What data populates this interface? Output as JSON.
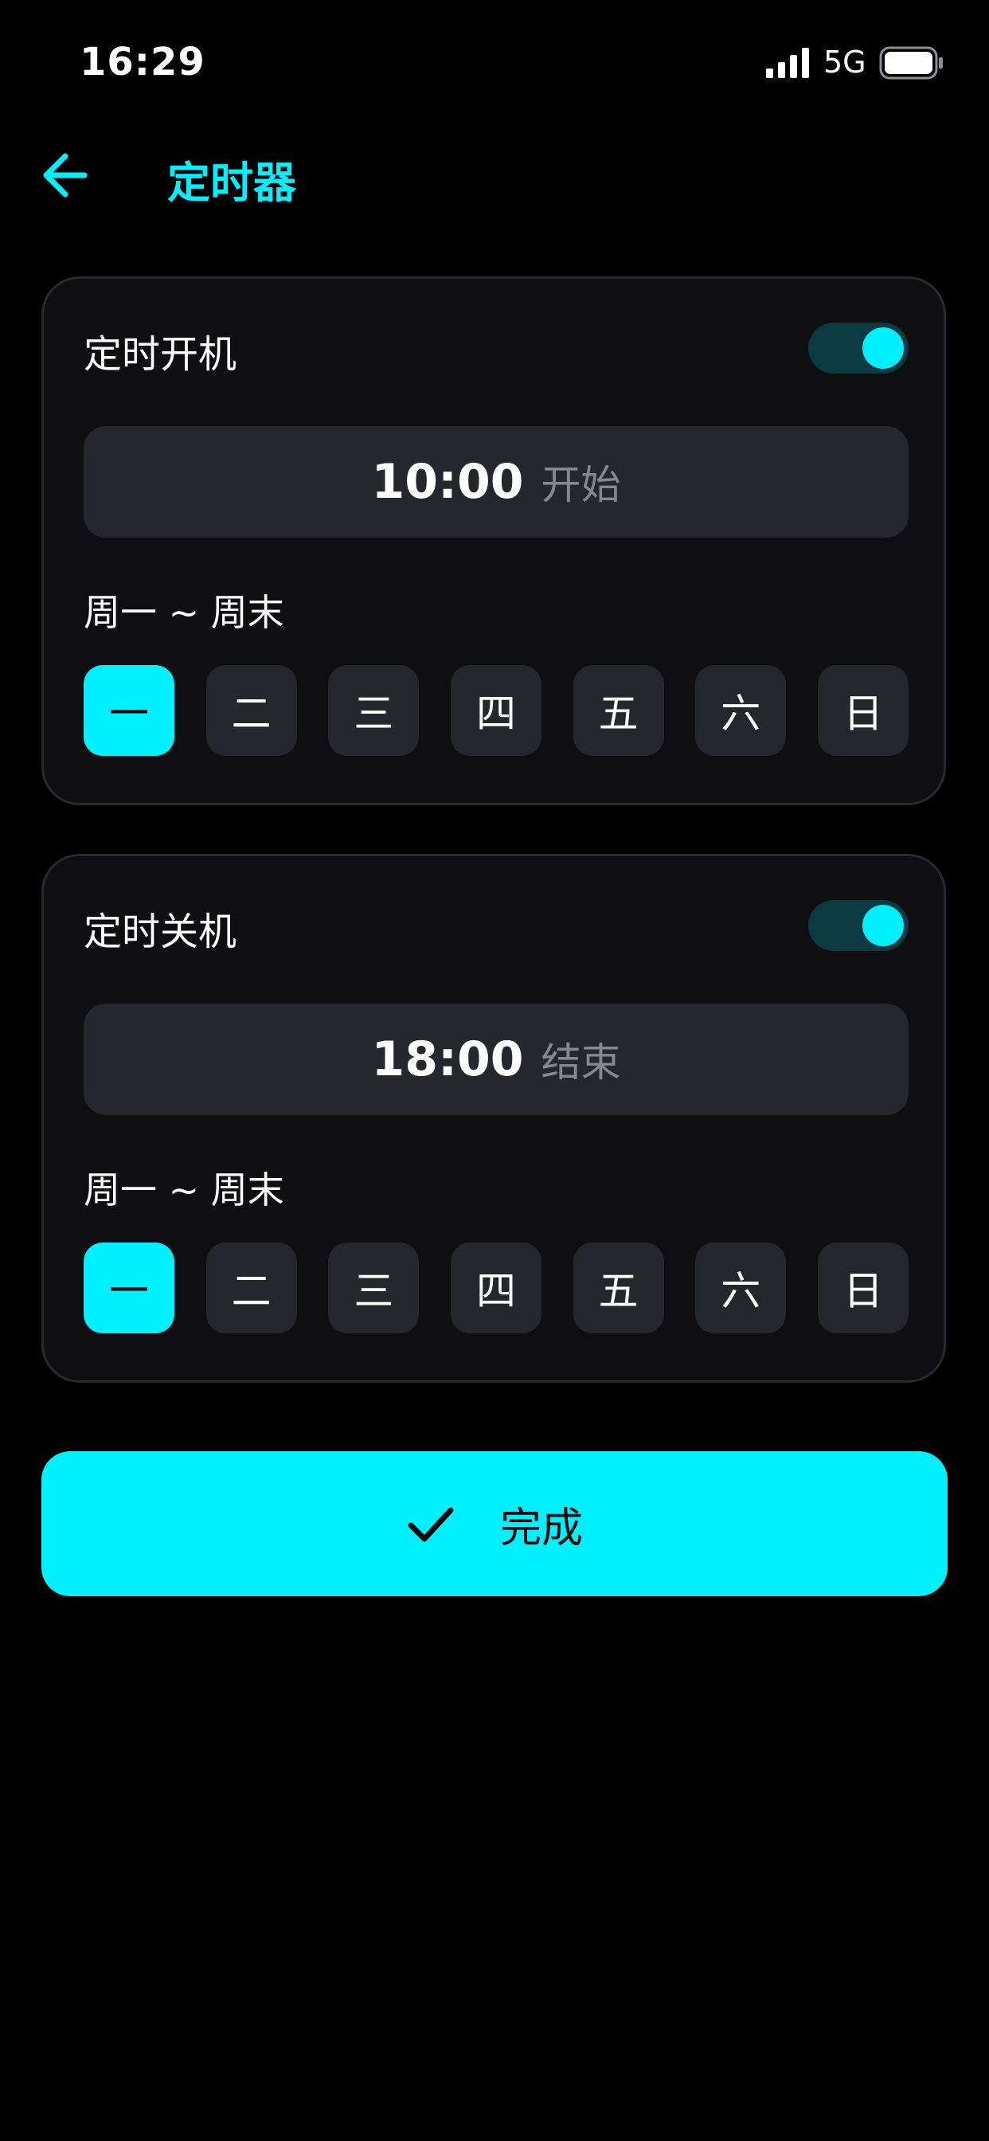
{
  "status_bar": {
    "time": "16:29",
    "network": "5G",
    "icons": [
      "signal-icon",
      "battery-icon"
    ]
  },
  "header": {
    "back_icon": "arrow-left-icon",
    "title": "定时器"
  },
  "colors": {
    "accent": "#00f0ff",
    "background": "#000000",
    "card": "#0f0f11",
    "field": "#25272c",
    "muted_text": "#86888e",
    "toggle_track": "#0b3b40"
  },
  "timers": [
    {
      "title": "定时开机",
      "enabled": true,
      "time": "10:00",
      "time_suffix": "开始",
      "repeat_label": "周一 ~ 周末",
      "days": [
        {
          "label": "一",
          "selected": true
        },
        {
          "label": "二",
          "selected": false
        },
        {
          "label": "三",
          "selected": false
        },
        {
          "label": "四",
          "selected": false
        },
        {
          "label": "五",
          "selected": false
        },
        {
          "label": "六",
          "selected": false
        },
        {
          "label": "日",
          "selected": false
        }
      ]
    },
    {
      "title": "定时关机",
      "enabled": true,
      "time": "18:00",
      "time_suffix": "结束",
      "repeat_label": "周一 ~ 周末",
      "days": [
        {
          "label": "一",
          "selected": true
        },
        {
          "label": "二",
          "selected": false
        },
        {
          "label": "三",
          "selected": false
        },
        {
          "label": "四",
          "selected": false
        },
        {
          "label": "五",
          "selected": false
        },
        {
          "label": "六",
          "selected": false
        },
        {
          "label": "日",
          "selected": false
        }
      ]
    }
  ],
  "done_button": {
    "icon": "check-icon",
    "label": "完成"
  }
}
